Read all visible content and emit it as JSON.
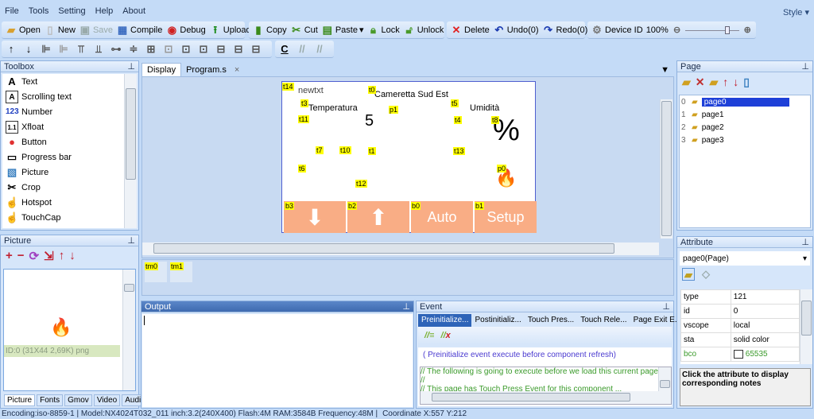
{
  "menu": [
    "File",
    "Tools",
    "Setting",
    "Help",
    "About"
  ],
  "style_label": "Style",
  "toolbar1": {
    "open": "Open",
    "new": "New",
    "save": "Save",
    "compile": "Compile",
    "debug": "Debug",
    "upload": "Upload",
    "copy": "Copy",
    "cut": "Cut",
    "paste": "Paste",
    "lock": "Lock",
    "unlock": "Unlock",
    "delete": "Delete",
    "undo": "Undo(0)",
    "redo": "Redo(0)",
    "device_id": "Device  ID",
    "zoom": "100%",
    "zoom_level_percent": 100
  },
  "toolbox": {
    "title": "Toolbox",
    "items": [
      "Text",
      "Scrolling text",
      "Number",
      "Xfloat",
      "Button",
      "Progress bar",
      "Picture",
      "Crop",
      "Hotspot",
      "TouchCap"
    ]
  },
  "picture": {
    "title": "Picture",
    "item": "ID:0  (31X44 2,69K) png",
    "tabs": [
      "Picture",
      "Fonts",
      "Gmov",
      "Video",
      "Audio"
    ]
  },
  "tabs": [
    "Display",
    "Program.s"
  ],
  "canvas": {
    "labels": {
      "newtxt": "newtxt",
      "title": "Cameretta Sud Est",
      "temp": "Temperatura",
      "hum": "Umidità",
      "digit": "5",
      "percent": "%"
    },
    "tags": [
      "t14",
      "t0",
      "t3",
      "p1",
      "t5",
      "t11",
      "t4",
      "t8",
      "t7",
      "t10",
      "t1",
      "t13",
      "t6",
      "p0",
      "t12",
      "b3",
      "b2",
      "b0",
      "b1"
    ],
    "buttons": {
      "b0": "Auto",
      "b1": "Setup"
    }
  },
  "timers": [
    "tm0",
    "tm1"
  ],
  "output": {
    "title": "Output"
  },
  "event": {
    "title": "Event",
    "tabs": [
      "Preinitialize...",
      "Postinitializ...",
      "Touch Pres...",
      "Touch Rele...",
      "Page Exit E..."
    ],
    "hint": "( Preinitialize event execute before component refresh)",
    "code": [
      "// The following is going to execute before we load this current page",
      "//",
      "// This page has Touch Press Event for this component ..."
    ]
  },
  "page": {
    "title": "Page",
    "items": [
      {
        "n": "0",
        "name": "page0"
      },
      {
        "n": "1",
        "name": "page1"
      },
      {
        "n": "2",
        "name": "page2"
      },
      {
        "n": "3",
        "name": "page3"
      }
    ]
  },
  "attribute": {
    "title": "Attribute",
    "selector": "page0(Page)",
    "rows": [
      [
        "type",
        "121"
      ],
      [
        "id",
        "0"
      ],
      [
        "vscope",
        "local"
      ],
      [
        "sta",
        "solid color"
      ],
      [
        "bco",
        "65535"
      ]
    ],
    "note": "Click the attribute to display corresponding notes"
  },
  "status": {
    "left": "Encoding:iso-8859-1 | Model:NX4024T032_011 inch:3.2(240X400) Flash:4M RAM:3584B Frequency:48M |",
    "coord": "Coordinate X:557  Y:212"
  }
}
